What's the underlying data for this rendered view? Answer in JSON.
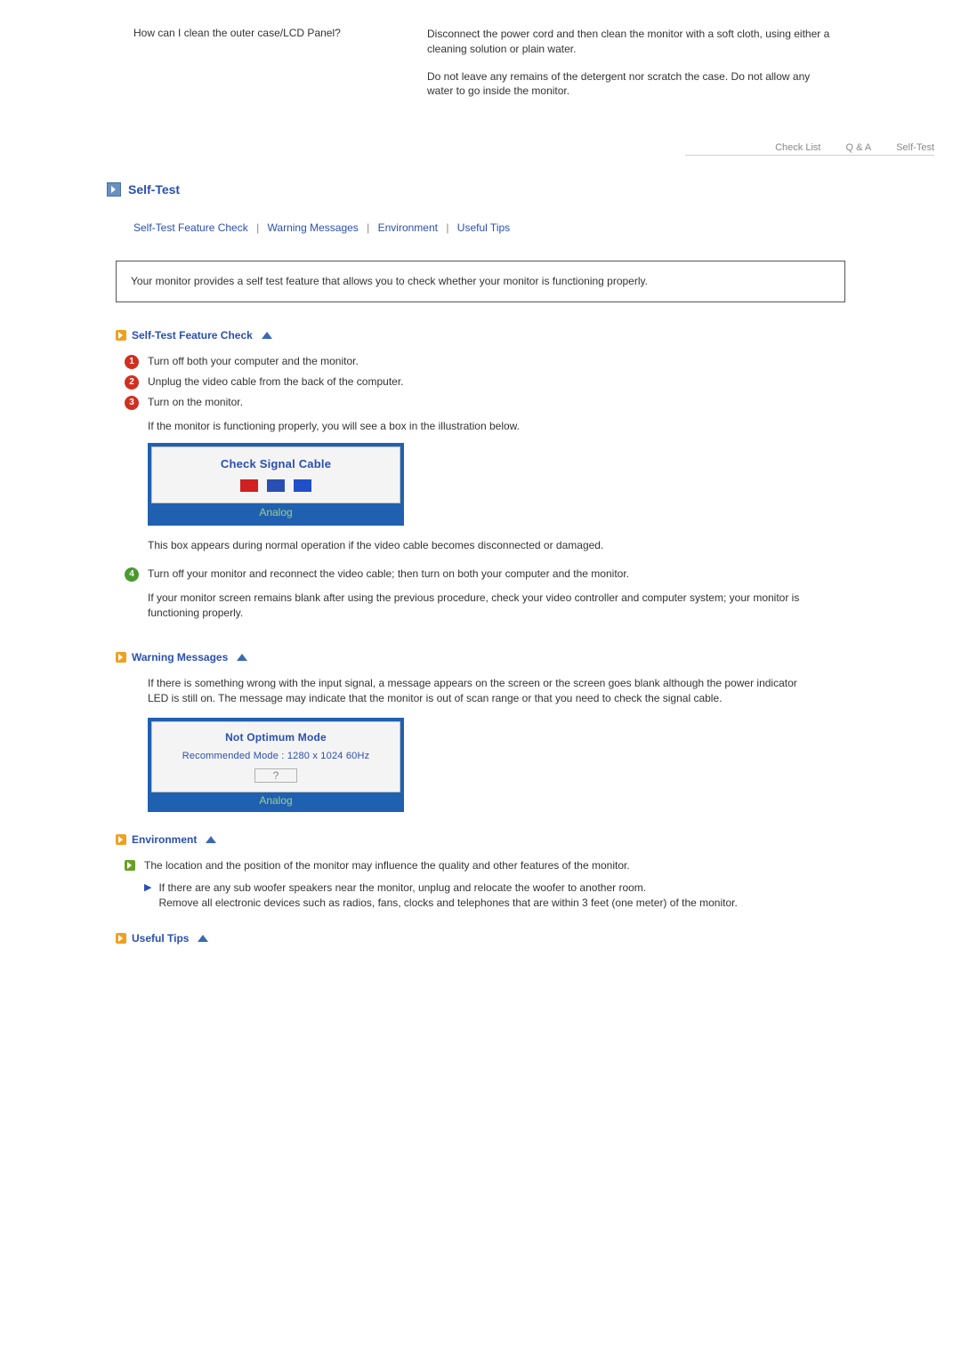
{
  "qa": {
    "question": "How can I clean the outer case/LCD Panel?",
    "answer1": "Disconnect the power cord and then clean the monitor with a soft cloth, using either a cleaning solution or plain water.",
    "answer2": "Do not leave any remains of the detergent nor scratch the case. Do not allow any water to go inside the monitor."
  },
  "tabs": {
    "checklist": "Check List",
    "qna": "Q & A",
    "selftest": "Self-Test"
  },
  "section": {
    "title": "Self-Test"
  },
  "anchors": {
    "a1": "Self-Test Feature Check",
    "a2": "Warning Messages",
    "a3": "Environment",
    "a4": "Useful Tips"
  },
  "intro": "Your monitor provides a self test feature that allows you to check whether your monitor is functioning properly.",
  "subheads": {
    "stfc": "Self-Test Feature Check",
    "warn": "Warning Messages",
    "env": "Environment",
    "tips": "Useful Tips"
  },
  "steps": {
    "s1": "Turn off both your computer and the monitor.",
    "s2": "Unplug the video cable from the back of the computer.",
    "s3": "Turn on the monitor.",
    "s3b": "If the monitor is functioning properly, you will see a box in the illustration below.",
    "s3after": "This box appears during normal operation if the video cable becomes disconnected or damaged.",
    "s4": "Turn off your monitor and reconnect the video cable; then turn on both your computer and the monitor.",
    "s4b": "If your monitor screen remains blank after using the previous procedure, check your video controller and computer system; your monitor is functioning properly."
  },
  "osd1": {
    "title": "Check Signal Cable",
    "mode": "Analog"
  },
  "warn_text": "If there is something wrong with the input signal, a message appears on the screen or the screen goes blank although the power indicator LED is still on. The message may indicate that the monitor is out of scan range or that you need to check the signal cable.",
  "osd2": {
    "line1": "Not Optimum Mode",
    "line2": "Recommended Mode : 1280 x 1024  60Hz",
    "q": "?",
    "mode": "Analog"
  },
  "env": {
    "b1": "The location and the position of the monitor may influence the quality and other features of the monitor.",
    "sub1": "If there are any sub woofer speakers near the monitor, unplug and relocate the woofer to another room.",
    "sub2": "Remove all electronic devices such as radios, fans, clocks and telephones that are within 3 feet (one meter) of the monitor."
  }
}
